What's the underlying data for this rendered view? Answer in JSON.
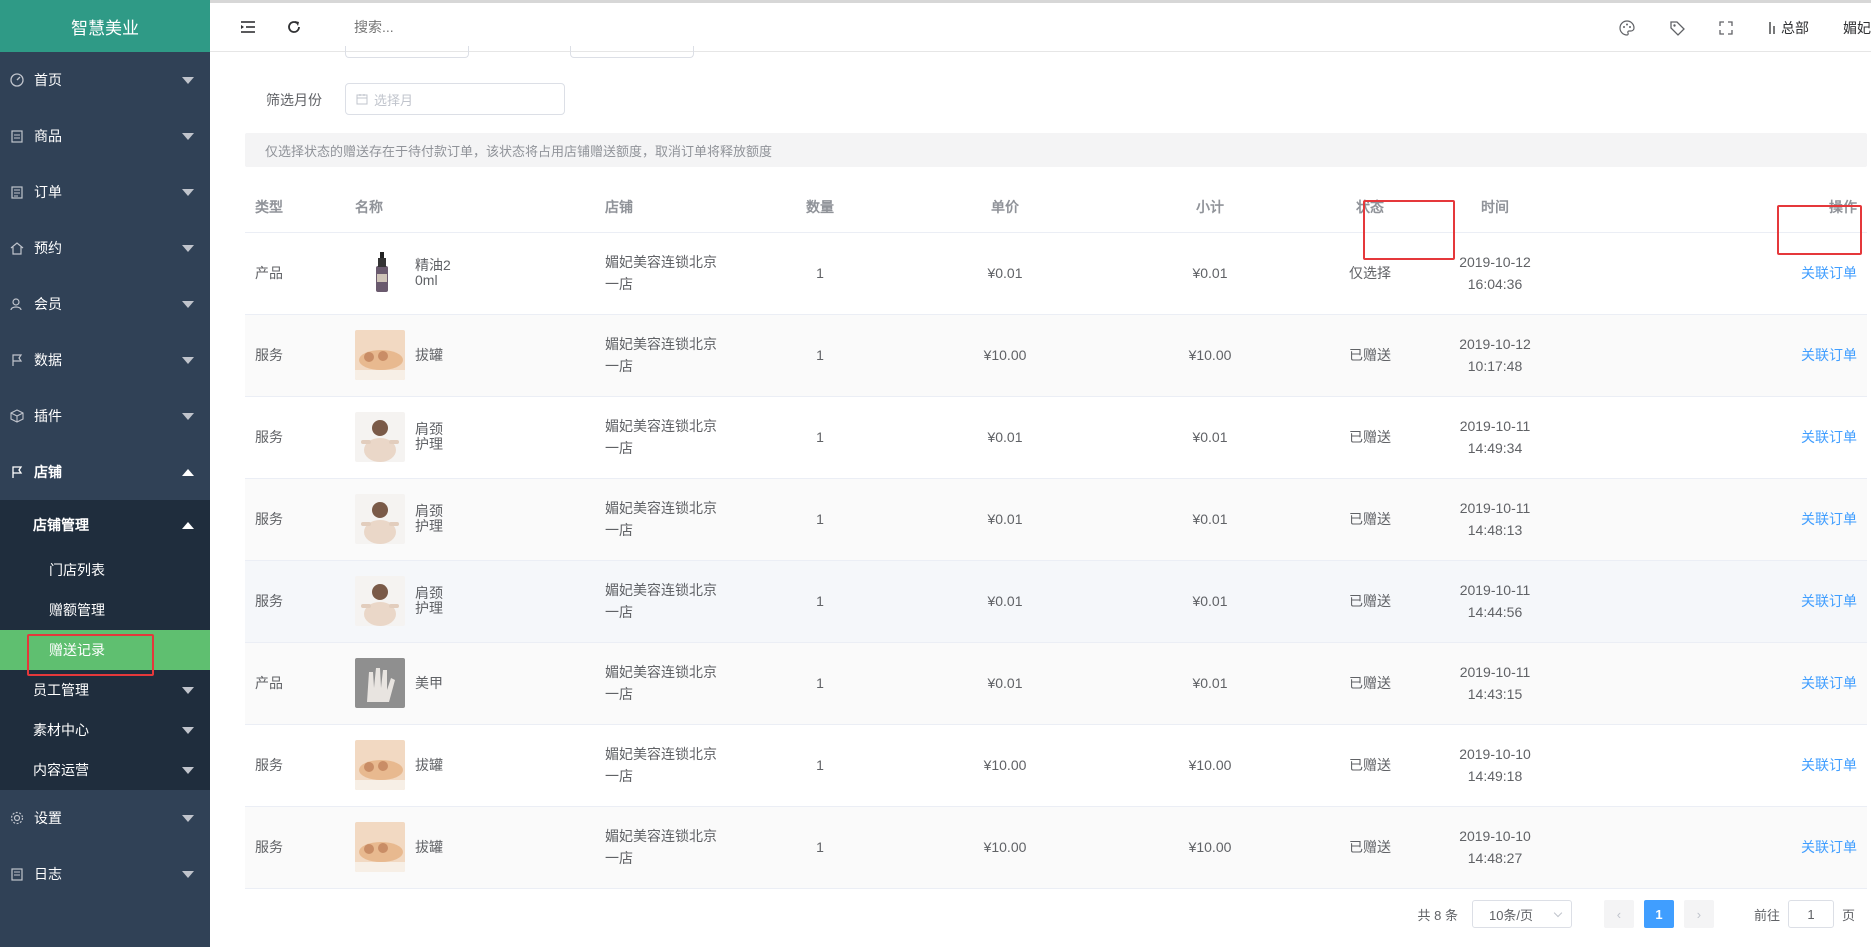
{
  "app": {
    "logo": "智慧美业"
  },
  "sidebar": {
    "items": [
      {
        "label": "首页",
        "icon": "dashboard-icon"
      },
      {
        "label": "商品",
        "icon": "goods-icon"
      },
      {
        "label": "订单",
        "icon": "order-icon"
      },
      {
        "label": "预约",
        "icon": "home-icon"
      },
      {
        "label": "会员",
        "icon": "members-icon"
      },
      {
        "label": "数据",
        "icon": "flag-icon"
      },
      {
        "label": "插件",
        "icon": "plugin-icon"
      },
      {
        "label": "店铺",
        "icon": "flag-icon"
      }
    ],
    "store_sub": {
      "manage_label": "店铺管理",
      "leaves": [
        "门店列表",
        "赠额管理",
        "赠送记录"
      ],
      "others": [
        "员工管理",
        "素材中心",
        "内容运营"
      ]
    },
    "bottom_items": [
      {
        "label": "设置",
        "icon": "settings-icon"
      },
      {
        "label": "日志",
        "icon": "log-icon"
      }
    ]
  },
  "navbar": {
    "search_placeholder": "搜索...",
    "branch_label": "总部",
    "user_label": "媚妃"
  },
  "filters": {
    "month_label": "筛选月份",
    "month_placeholder": "选择月"
  },
  "notice": "仅选择状态的赠送存在于待付款订单，该状态将占用店铺赠送额度，取消订单将释放额度",
  "table": {
    "headers": {
      "type": "类型",
      "name": "名称",
      "store": "店铺",
      "qty": "数量",
      "price": "单价",
      "subtotal": "小计",
      "status": "状态",
      "time": "时间",
      "action": "操作"
    },
    "rows": [
      {
        "type": "产品",
        "name": "精油20ml",
        "thumb": "oil",
        "store": "媚妃美容连锁北京一店",
        "qty": "1",
        "price": "¥0.01",
        "subtotal": "¥0.01",
        "status": "仅选择",
        "date": "2019-10-12",
        "time": "16:04:36",
        "action": "关联订单"
      },
      {
        "type": "服务",
        "name": "拔罐",
        "thumb": "cupping",
        "store": "媚妃美容连锁北京一店",
        "qty": "1",
        "price": "¥10.00",
        "subtotal": "¥10.00",
        "status": "已赠送",
        "date": "2019-10-12",
        "time": "10:17:48",
        "action": "关联订单"
      },
      {
        "type": "服务",
        "name": "肩颈护理",
        "thumb": "neck",
        "store": "媚妃美容连锁北京一店",
        "qty": "1",
        "price": "¥0.01",
        "subtotal": "¥0.01",
        "status": "已赠送",
        "date": "2019-10-11",
        "time": "14:49:34",
        "action": "关联订单"
      },
      {
        "type": "服务",
        "name": "肩颈护理",
        "thumb": "neck",
        "store": "媚妃美容连锁北京一店",
        "qty": "1",
        "price": "¥0.01",
        "subtotal": "¥0.01",
        "status": "已赠送",
        "date": "2019-10-11",
        "time": "14:48:13",
        "action": "关联订单"
      },
      {
        "type": "服务",
        "name": "肩颈护理",
        "thumb": "neck",
        "store": "媚妃美容连锁北京一店",
        "qty": "1",
        "price": "¥0.01",
        "subtotal": "¥0.01",
        "status": "已赠送",
        "date": "2019-10-11",
        "time": "14:44:56",
        "action": "关联订单"
      },
      {
        "type": "产品",
        "name": "美甲",
        "thumb": "nail",
        "store": "媚妃美容连锁北京一店",
        "qty": "1",
        "price": "¥0.01",
        "subtotal": "¥0.01",
        "status": "已赠送",
        "date": "2019-10-11",
        "time": "14:43:15",
        "action": "关联订单"
      },
      {
        "type": "服务",
        "name": "拔罐",
        "thumb": "cupping",
        "store": "媚妃美容连锁北京一店",
        "qty": "1",
        "price": "¥10.00",
        "subtotal": "¥10.00",
        "status": "已赠送",
        "date": "2019-10-10",
        "time": "14:49:18",
        "action": "关联订单"
      },
      {
        "type": "服务",
        "name": "拔罐",
        "thumb": "cupping",
        "store": "媚妃美容连锁北京一店",
        "qty": "1",
        "price": "¥10.00",
        "subtotal": "¥10.00",
        "status": "已赠送",
        "date": "2019-10-10",
        "time": "14:48:27",
        "action": "关联订单"
      }
    ]
  },
  "pagination": {
    "total": "共 8 条",
    "page_size": "10条/页",
    "current_page": "1",
    "goto_prefix": "前往",
    "goto_value": "1",
    "goto_suffix": "页"
  },
  "colors": {
    "sidebar_bg": "#304156",
    "logo_bg": "#2f9a86",
    "active_leaf": "#5fbf70",
    "link": "#409eff",
    "success": "#67c23a",
    "highlight_border": "#e5383b"
  }
}
